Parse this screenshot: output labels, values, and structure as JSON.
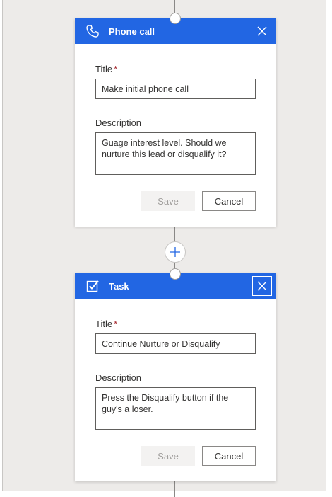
{
  "cards": [
    {
      "header_title": "Phone call",
      "header_icon": "phone-icon",
      "title_label": "Title",
      "required_mark": "*",
      "title_value": "Make initial phone call",
      "description_label": "Description",
      "description_value": "Guage interest level. Should we\nnurture this lead or disqualify it?",
      "save_label": "Save",
      "cancel_label": "Cancel"
    },
    {
      "header_title": "Task",
      "header_icon": "checkbox-icon",
      "title_label": "Title",
      "required_mark": "*",
      "title_value": "Continue Nurture or Disqualify",
      "description_label": "Description",
      "description_value": "Press the Disqualify button if the\nguy's a loser.",
      "save_label": "Save",
      "cancel_label": "Cancel"
    }
  ],
  "add_step_icon": "plus-icon",
  "colors": {
    "header_blue": "#2266e3",
    "canvas_gray": "#edebe9"
  }
}
